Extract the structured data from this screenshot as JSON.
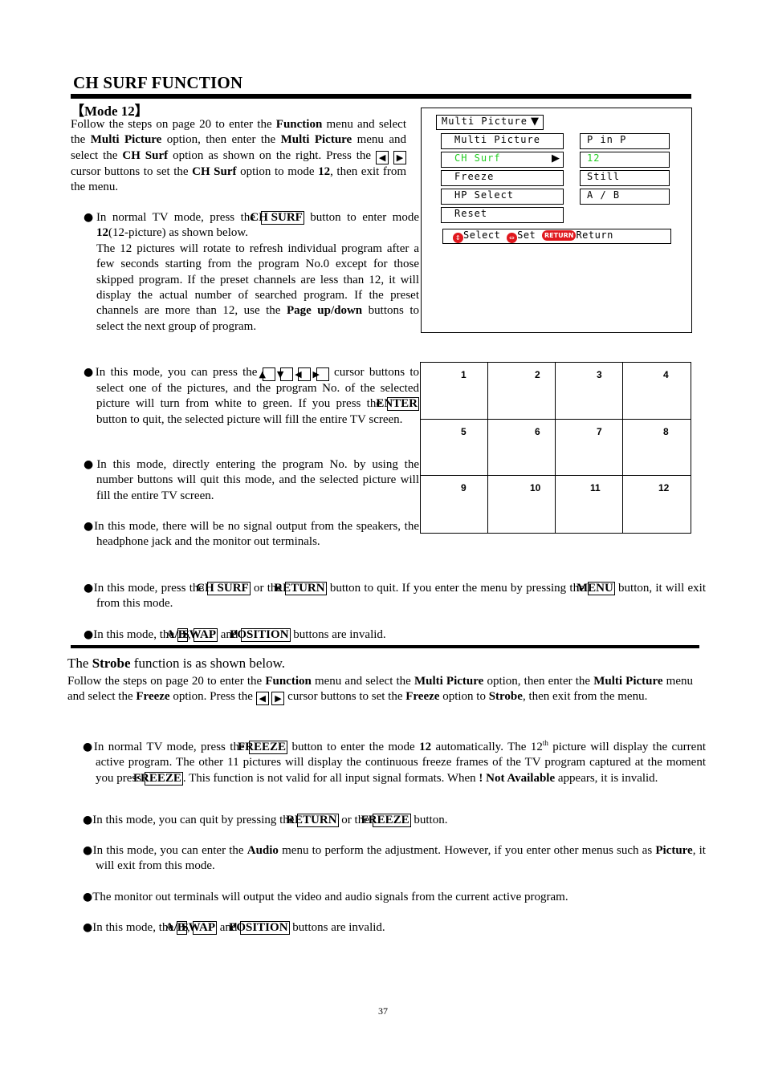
{
  "title": "CH SURF FUNCTION",
  "mode_heading": "【Mode 12】",
  "intro": {
    "t1": "Follow the steps on page 20 to enter the ",
    "b1": "Function",
    "t2": " menu and select the ",
    "b2": "Multi Picture",
    "t3": " option, then enter the ",
    "b3": "Multi Picture",
    "t4": " menu and select the ",
    "b4": "CH Surf",
    "t5": " option as shown on the right. Press the ",
    "t6": " cursor buttons to set the ",
    "b5": "CH Surf",
    "t7": " option to mode ",
    "b6": "12",
    "t8": ", then exit from the menu."
  },
  "keys": {
    "left": "◀",
    "right": "▶",
    "up": "▲",
    "down": "▼",
    "ch_surf": "CH SURF",
    "enter": "ENTER",
    "return": "RETURN",
    "menu": "MENU",
    "ab": "A/B",
    "swap": "SWAP",
    "position": "POSITION",
    "freeze": "FREEZE"
  },
  "bullets_mode12": [
    {
      "t1": "In normal TV mode, press the ",
      "t2": " button to enter mode ",
      "b1": "12",
      "t3": "(12-picture) as shown below.",
      "t4": "The 12 pictures will rotate to refresh individual program after a few seconds starting from the program No.0 except for those skipped program. If the preset channels are less than 12, it will display the actual number of searched program. If the preset channels are more than 12, use the ",
      "b2": "Page up/down",
      "t5": " buttons to select the next group of program."
    },
    {
      "t1": "In this mode, you can press the ",
      "t2": " cursor buttons to select one of the pictures, and the program No. of the selected picture will turn from white to green. If you press the ",
      "t3": " button to quit, the selected picture will fill the entire TV screen."
    },
    {
      "t1": "In this mode, directly entering the program No. by using the number buttons will quit this mode, and the selected picture will fill the entire TV screen."
    },
    {
      "t1": "In this mode, there will be no signal output from the speakers, the headphone jack and the monitor out terminals."
    },
    {
      "t1": "In this mode, press the ",
      "t2": " or the ",
      "t3": " button to quit. If you enter the menu by pressing the ",
      "t4": " button, it will exit from this mode."
    },
    {
      "t1": "In this mode, the ",
      "t2": ", ",
      "t3": " and ",
      "t4": " buttons are invalid."
    }
  ],
  "osd": {
    "header": "Multi Picture",
    "header_arrow": "▼",
    "menu_items": [
      "Multi Picture",
      "CH Surf",
      "Freeze",
      "HP Select",
      "Reset"
    ],
    "selected_arrow": "▶",
    "values": [
      "P in P",
      "12",
      "Still",
      "A / B"
    ],
    "highlight_color": "#22cc22",
    "status": {
      "select_icon": "⇕",
      "select_label": "Select",
      "set_icon": "⇔",
      "set_label": "Set",
      "return_badge": "RETURN",
      "return_label": "Return"
    }
  },
  "grid_numbers": [
    "1",
    "2",
    "3",
    "4",
    "5",
    "6",
    "7",
    "8",
    "9",
    "10",
    "11",
    "12"
  ],
  "strobe": {
    "heading_t1": "The ",
    "heading_b": "Strobe",
    "heading_t2": " function is as shown below.",
    "intro": {
      "t1": "Follow the steps on page 20 to enter the ",
      "b1": "Function",
      "t2": " menu and select the ",
      "b2": "Multi Picture",
      "t3": " option, then enter the ",
      "b3": "Multi Picture",
      "t4": " menu and select the ",
      "b4": "Freeze",
      "t5": " option. Press the ",
      "t6": " cursor buttons to set the ",
      "b5": "Freeze",
      "t7": " option to ",
      "b6": "Strobe",
      "t8": ", then exit from the menu."
    },
    "bullets": [
      {
        "t1": "In normal TV mode, press the ",
        "t2": " button to enter the mode ",
        "b1": "12",
        "t3": " automatically. The 12",
        "sup": "th",
        "t4": " picture will display the current active program. The other 11 pictures will display the continuous freeze frames of the TV program captured at the moment you press ",
        "t5": ". This function is not valid for all input signal formats. When ",
        "b2": " !  Not Available",
        "t6": " appears, it is invalid."
      },
      {
        "t1": "In this mode, you can quit by pressing the ",
        "t2": " or the ",
        "t3": " button."
      },
      {
        "t1": "In this mode, you can enter the ",
        "b1": "Audio",
        "t2": " menu to perform the adjustment. However, if you enter other menus such as ",
        "b2": "Picture",
        "t3": ", it will exit from this mode."
      },
      {
        "t1": "The monitor out terminals will output the video and audio signals from the current active program."
      },
      {
        "t1": "In this mode, the ",
        "t2": ", ",
        "t3": " and ",
        "t4": " buttons are invalid."
      }
    ]
  },
  "bullet_glyph": "●",
  "page_number": "37"
}
